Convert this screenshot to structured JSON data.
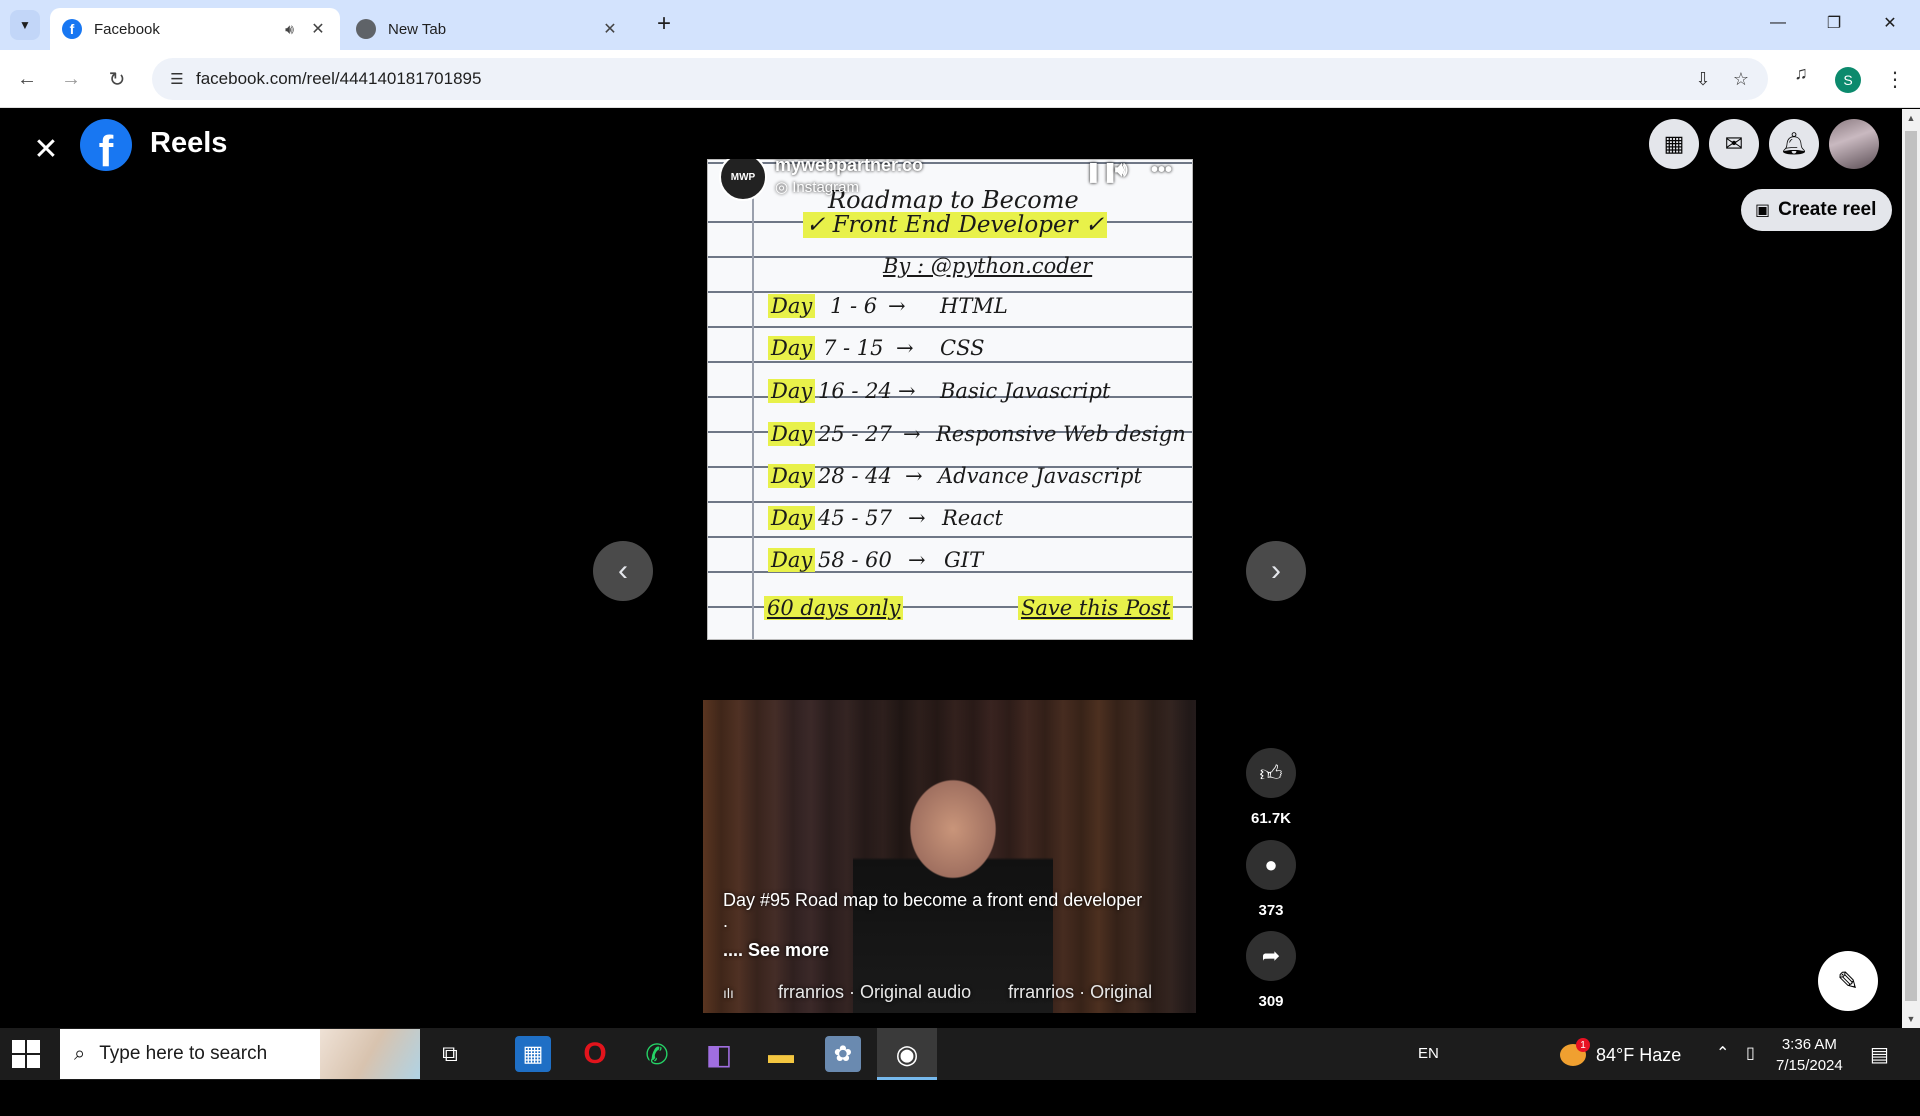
{
  "browser": {
    "tabs": [
      {
        "title": "Facebook",
        "active": true,
        "audio": true
      },
      {
        "title": "New Tab",
        "active": false
      }
    ],
    "url": "facebook.com/reel/444140181701895",
    "profile_initial": "S"
  },
  "header": {
    "title": "Reels",
    "create_reel_label": "Create reel"
  },
  "reel": {
    "channel_name": "mywebpartner.co",
    "channel_source": "Instagram",
    "avatar_text": "MWP",
    "notebook": {
      "title_line1": "Roadmap to Become",
      "title_line2": "✓ Front End Developer ✓",
      "by_line": "By : @python.coder",
      "rows": [
        {
          "day": "Day",
          "range": "1 - 6",
          "topic": "HTML"
        },
        {
          "day": "Day",
          "range": "7 - 15",
          "topic": "CSS"
        },
        {
          "day": "Day",
          "range": "16 - 24",
          "topic": "Basic Javascript"
        },
        {
          "day": "Day",
          "range": "25 - 27",
          "topic": "Responsive Web design"
        },
        {
          "day": "Day",
          "range": "28 - 44",
          "topic": "Advance Javascript"
        },
        {
          "day": "Day",
          "range": "45 - 57",
          "topic": "React"
        },
        {
          "day": "Day",
          "range": "58 - 60",
          "topic": "GIT"
        }
      ],
      "footer_left": "60 days only",
      "footer_right": "Save this Post"
    },
    "caption": "Day #95 Road map to become a front end developer",
    "caption_cont": ".",
    "see_more": ".... See more",
    "audio_text_1": "frranrios · Original audio",
    "audio_text_2": "frranrios · Original",
    "likes": "61.7K",
    "comments": "373",
    "shares": "309"
  },
  "taskbar": {
    "search_placeholder": "Type here to search",
    "language": "EN",
    "weather": "84°F  Haze",
    "weather_badge": "1",
    "time": "3:36 AM",
    "date": "7/15/2024"
  },
  "colors": {
    "facebook_blue": "#1877f2",
    "tabstrip": "#d3e3fd",
    "highlight": "#e8f14a"
  }
}
